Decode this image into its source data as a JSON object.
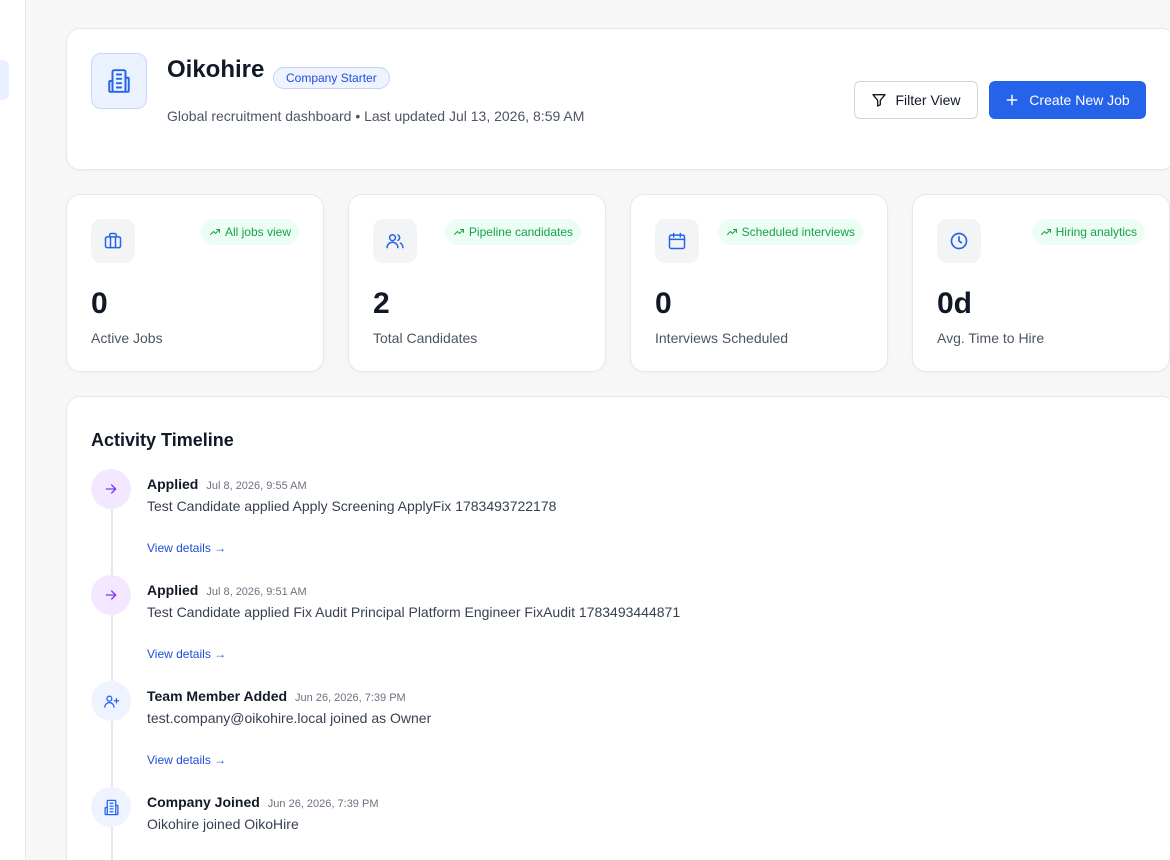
{
  "header": {
    "company_name": "Oikohire",
    "plan_badge": "Company Starter",
    "subtitle": "Global recruitment dashboard • Last updated Jul 13, 2026, 8:59 AM",
    "filter_button": "Filter View",
    "create_button": "Create New Job"
  },
  "stats": [
    {
      "icon": "briefcase-icon",
      "pill": "All jobs view",
      "value": "0",
      "label": "Active Jobs"
    },
    {
      "icon": "users-icon",
      "pill": "Pipeline candidates",
      "value": "2",
      "label": "Total Candidates"
    },
    {
      "icon": "calendar-icon",
      "pill": "Scheduled interviews",
      "value": "0",
      "label": "Interviews Scheduled"
    },
    {
      "icon": "clock-icon",
      "pill": "Hiring analytics",
      "value": "0d",
      "label": "Avg. Time to Hire"
    }
  ],
  "timeline": {
    "title": "Activity Timeline",
    "items": [
      {
        "type": "Applied",
        "time": "Jul 8, 2026, 9:55 AM",
        "description": "Test Candidate applied Apply Screening ApplyFix 1783493722178",
        "link": "View details →",
        "icon": "arrow-right-icon"
      },
      {
        "type": "Applied",
        "time": "Jul 8, 2026, 9:51 AM",
        "description": "Test Candidate applied Fix Audit Principal Platform Engineer FixAudit 1783493444871",
        "link": "View details →",
        "icon": "arrow-right-icon"
      },
      {
        "type": "Team Member Added",
        "time": "Jun 26, 2026, 7:39 PM",
        "description": "test.company@oikohire.local joined as Owner",
        "link": "View details →",
        "icon": "user-plus-icon"
      },
      {
        "type": "Company Joined",
        "time": "Jun 26, 2026, 7:39 PM",
        "description": "Oikohire joined OikoHire",
        "link": "",
        "icon": "building-icon"
      }
    ]
  },
  "colors": {
    "accent": "#2563eb",
    "success": "#16a34a",
    "purple": "#7c3aed"
  }
}
